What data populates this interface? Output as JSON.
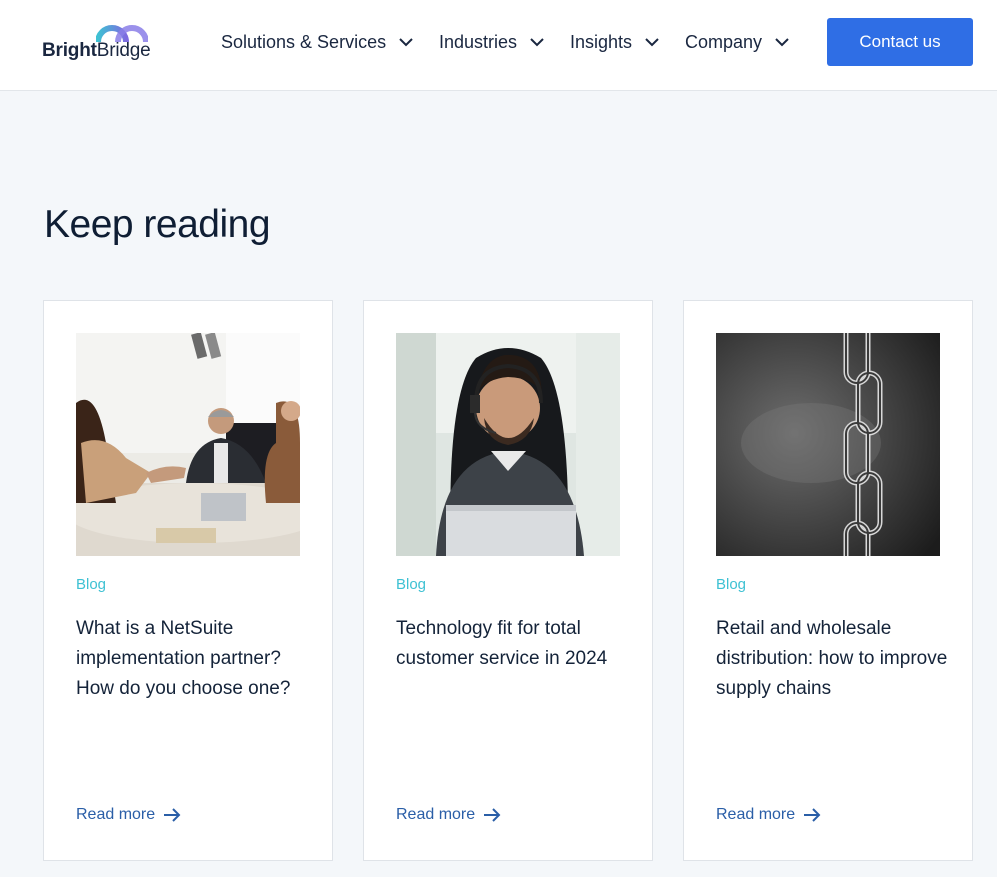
{
  "header": {
    "logo": {
      "part1": "Bright",
      "part2": "Bridge"
    },
    "nav": [
      {
        "label": "Solutions & Services"
      },
      {
        "label": "Industries"
      },
      {
        "label": "Insights"
      },
      {
        "label": "Company"
      }
    ],
    "cta_label": "Contact us"
  },
  "main": {
    "title": "Keep reading",
    "cards": [
      {
        "tag": "Blog",
        "title": "What is a NetSuite implementation partner? How do you choose one?",
        "link": "Read more",
        "image": "business-handshake-meeting-photo"
      },
      {
        "tag": "Blog",
        "title": "Technology fit for total customer service in 2024",
        "link": "Read more",
        "image": "support-agent-headset-photo"
      },
      {
        "tag": "Blog",
        "title": "Retail and wholesale distribution: how to improve supply chains",
        "link": "Read more",
        "image": "metal-chain-photo"
      }
    ]
  },
  "colors": {
    "accent": "#2f6ee5",
    "tag": "#3ec1d3",
    "link": "#2a5ea7",
    "background": "#f4f7fa"
  }
}
